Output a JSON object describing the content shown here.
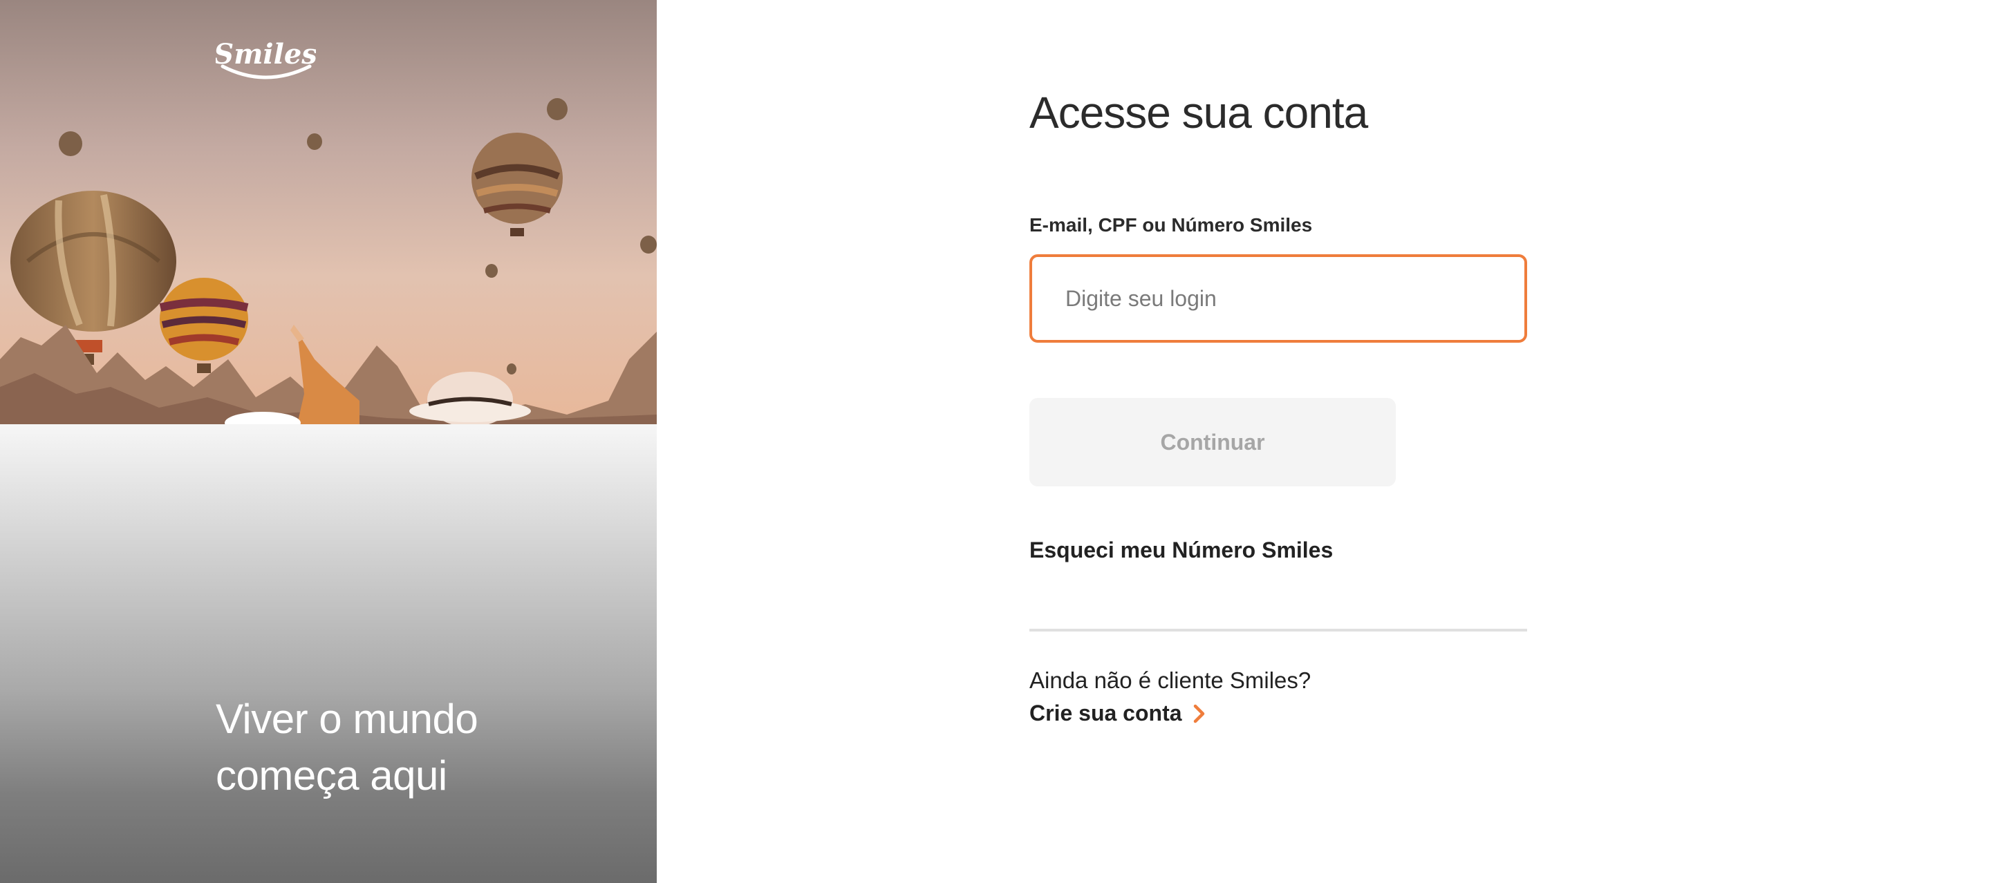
{
  "brand": {
    "logo_text": "Smiles",
    "accent_color": "#ef7d3c"
  },
  "hero": {
    "tagline_line1": "Viver o mundo",
    "tagline_line2": "começa aqui"
  },
  "login": {
    "title": "Acesse sua conta",
    "login_field": {
      "label": "E-mail, CPF ou Número Smiles",
      "placeholder": "Digite seu login",
      "value": ""
    },
    "continue_label": "Continuar",
    "forgot_label": "Esqueci meu Número Smiles",
    "signup_question": "Ainda não é cliente Smiles?",
    "signup_label": "Crie sua conta"
  },
  "icons": {
    "signup_arrow": "chevron-right-icon"
  }
}
